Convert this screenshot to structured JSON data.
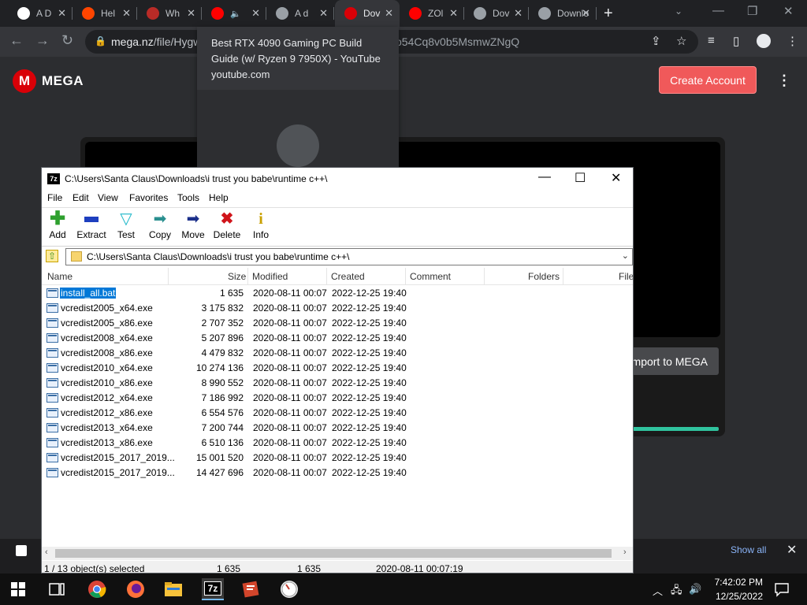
{
  "browser": {
    "tabs": [
      {
        "title": "A D",
        "favicon": "google-icon",
        "active": false
      },
      {
        "title": "Hel",
        "favicon": "reddit-icon",
        "active": false
      },
      {
        "title": "Wh",
        "favicon": "quora-icon",
        "active": false
      },
      {
        "title": "",
        "favicon": "youtube-icon",
        "active": false,
        "audio": true
      },
      {
        "title": "A d",
        "favicon": "tab-icon",
        "active": false
      },
      {
        "title": "Dov",
        "favicon": "mega-icon",
        "active": true
      },
      {
        "title": "ZOl",
        "favicon": "youtube-icon",
        "active": false
      },
      {
        "title": "Dov",
        "favicon": "globe-icon",
        "active": false
      },
      {
        "title": "Downlo",
        "favicon": "globe-icon",
        "active": false
      }
    ],
    "address_host": "mega.nz",
    "address_path": "/file/Hygw",
    "address_tail": "o54Cq8v0b5MsmwZNgQ",
    "tooltip": {
      "title": "Best RTX 4090 Gaming PC Build Guide (w/ Ryzen 9 7950X) - YouTube",
      "domain": "youtube.com"
    }
  },
  "mega": {
    "brand": "MEGA",
    "create_account": "Create Account",
    "import_label": "mport to MEGA",
    "show_all": "Show all"
  },
  "zip": {
    "title": "C:\\Users\\Santa Claus\\Downloads\\i trust you babe\\runtime c++\\",
    "app_icon_label": "7z",
    "menu": [
      "File",
      "Edit",
      "View",
      "Favorites",
      "Tools",
      "Help"
    ],
    "tools": [
      {
        "label": "Add",
        "icon": "add-icon",
        "color": "#2ea02e"
      },
      {
        "label": "Extract",
        "icon": "extract-icon",
        "color": "#1e3fbf"
      },
      {
        "label": "Test",
        "icon": "test-icon",
        "color": "#1fb8c9"
      },
      {
        "label": "Copy",
        "icon": "copy-icon",
        "color": "#2a8f8f"
      },
      {
        "label": "Move",
        "icon": "move-icon",
        "color": "#1b2f8a"
      },
      {
        "label": "Delete",
        "icon": "delete-icon",
        "color": "#d0141a"
      },
      {
        "label": "Info",
        "icon": "info-icon",
        "color": "#c9a000"
      }
    ],
    "path": "C:\\Users\\Santa Claus\\Downloads\\i trust you babe\\runtime c++\\",
    "columns": {
      "name": "Name",
      "size": "Size",
      "modified": "Modified",
      "created": "Created",
      "comment": "Comment",
      "folders": "Folders",
      "files": "File"
    },
    "files": [
      {
        "name": "install_all.bat",
        "size": "1 635",
        "modified": "2020-08-11 00:07",
        "created": "2022-12-25 19:40",
        "selected": true
      },
      {
        "name": "vcredist2005_x64.exe",
        "size": "3 175 832",
        "modified": "2020-08-11 00:07",
        "created": "2022-12-25 19:40"
      },
      {
        "name": "vcredist2005_x86.exe",
        "size": "2 707 352",
        "modified": "2020-08-11 00:07",
        "created": "2022-12-25 19:40"
      },
      {
        "name": "vcredist2008_x64.exe",
        "size": "5 207 896",
        "modified": "2020-08-11 00:07",
        "created": "2022-12-25 19:40"
      },
      {
        "name": "vcredist2008_x86.exe",
        "size": "4 479 832",
        "modified": "2020-08-11 00:07",
        "created": "2022-12-25 19:40"
      },
      {
        "name": "vcredist2010_x64.exe",
        "size": "10 274 136",
        "modified": "2020-08-11 00:07",
        "created": "2022-12-25 19:40"
      },
      {
        "name": "vcredist2010_x86.exe",
        "size": "8 990 552",
        "modified": "2020-08-11 00:07",
        "created": "2022-12-25 19:40"
      },
      {
        "name": "vcredist2012_x64.exe",
        "size": "7 186 992",
        "modified": "2020-08-11 00:07",
        "created": "2022-12-25 19:40"
      },
      {
        "name": "vcredist2012_x86.exe",
        "size": "6 554 576",
        "modified": "2020-08-11 00:07",
        "created": "2022-12-25 19:40"
      },
      {
        "name": "vcredist2013_x64.exe",
        "size": "7 200 744",
        "modified": "2020-08-11 00:07",
        "created": "2022-12-25 19:40"
      },
      {
        "name": "vcredist2013_x86.exe",
        "size": "6 510 136",
        "modified": "2020-08-11 00:07",
        "created": "2022-12-25 19:40"
      },
      {
        "name": "vcredist2015_2017_2019...",
        "size": "15 001 520",
        "modified": "2020-08-11 00:07",
        "created": "2022-12-25 19:40"
      },
      {
        "name": "vcredist2015_2017_2019...",
        "size": "14 427 696",
        "modified": "2020-08-11 00:07",
        "created": "2022-12-25 19:40"
      }
    ],
    "status": {
      "selection": "1 / 13 object(s) selected",
      "size": "1 635",
      "packed": "1 635",
      "date": "2020-08-11 00:07:19"
    }
  },
  "taskbar": {
    "time": "7:42:02 PM",
    "date": "12/25/2022",
    "apps": [
      "start-icon",
      "task-view-icon",
      "chrome-icon",
      "firefox-icon",
      "file-explorer-icon",
      "7zip-icon",
      "app-icon",
      "clock-app-icon"
    ]
  }
}
